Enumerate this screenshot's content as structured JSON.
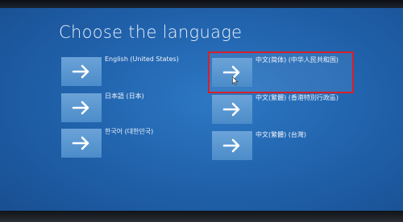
{
  "screen": {
    "title": "Choose the language"
  },
  "languages": [
    {
      "label": "English (United States)",
      "icon": "arrow-right-icon",
      "selected": false
    },
    {
      "label": "中文(简体) (中华人民共和国)",
      "icon": "arrow-right-icon",
      "selected": true
    },
    {
      "label": "日本語 (日本)",
      "icon": "arrow-right-icon",
      "selected": false
    },
    {
      "label": "中文(繁體) (香港特別行政區)",
      "icon": "arrow-right-icon",
      "selected": false
    },
    {
      "label": "한국어 (대한민국)",
      "icon": "arrow-right-icon",
      "selected": false
    },
    {
      "label": "中文(繁體) (台灣)",
      "icon": "arrow-right-icon",
      "selected": false
    }
  ],
  "colors": {
    "background": "#1f5fa8",
    "tile": "#5b97d0",
    "selection_outline": "#d6202a",
    "text": "#eef4fb"
  }
}
